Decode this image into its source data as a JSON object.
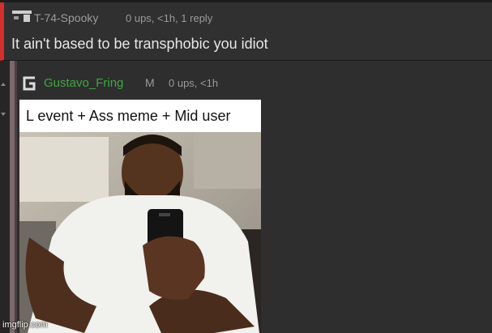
{
  "comment_parent": {
    "username": "T-74-Spooky",
    "meta": "0 ups, <1h, 1 reply",
    "text": "It ain't based to be transphobic you idiot",
    "accent_color": "#d62d2d"
  },
  "comment_reply": {
    "username": "Gustavo_Fring",
    "mod_badge": "M",
    "meta": "0 ups, <1h",
    "username_color": "#3ea83e",
    "meme": {
      "caption": "L event + Ass meme + Mid user",
      "image_description_icon": "selfie-photo"
    }
  },
  "watermark": "imgflip.com"
}
